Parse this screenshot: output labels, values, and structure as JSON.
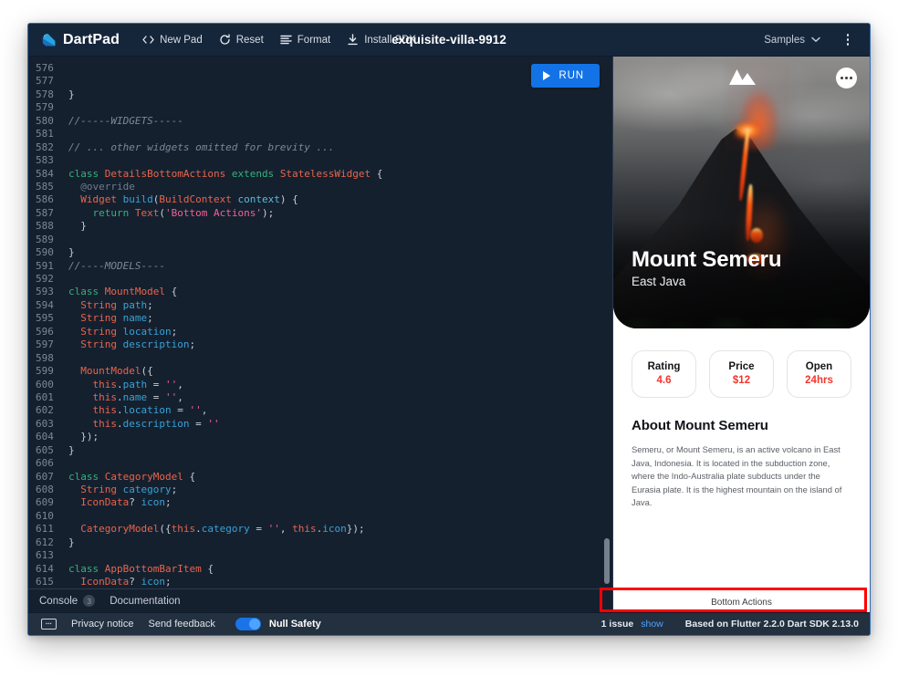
{
  "toolbar": {
    "brand": "DartPad",
    "items": [
      {
        "icon": "code-brackets-icon",
        "label": "New Pad"
      },
      {
        "icon": "refresh-icon",
        "label": "Reset"
      },
      {
        "icon": "format-lines-icon",
        "label": "Format"
      },
      {
        "icon": "download-icon",
        "label": "Install SDK"
      }
    ],
    "doc_title": "exquisite-villa-9912",
    "samples_label": "Samples",
    "overflow_icon": "kebab-menu-icon"
  },
  "editor": {
    "run_label": "RUN",
    "first_line": 576,
    "lines": [
      [
        [
          "pl",
          ""
        ]
      ],
      [
        [
          "pl",
          ""
        ]
      ],
      [
        [
          "pl",
          "}"
        ]
      ],
      [
        [
          "pl",
          ""
        ]
      ],
      [
        [
          "cm",
          "//-----WIDGETS-----"
        ]
      ],
      [
        [
          "pl",
          ""
        ]
      ],
      [
        [
          "cm",
          "// ... other widgets omitted for brevity ..."
        ]
      ],
      [
        [
          "pl",
          ""
        ]
      ],
      [
        [
          "k",
          "class "
        ],
        [
          "ty",
          "DetailsBottomActions"
        ],
        [
          "k",
          " extends "
        ],
        [
          "ty",
          "StatelessWidget"
        ],
        [
          "pl",
          " {"
        ]
      ],
      [
        [
          "an",
          "  @override"
        ]
      ],
      [
        [
          "pl",
          "  "
        ],
        [
          "ty",
          "Widget"
        ],
        [
          "pl",
          " "
        ],
        [
          "fn",
          "build"
        ],
        [
          "pl",
          "("
        ],
        [
          "ty",
          "BuildContext"
        ],
        [
          "pl",
          " "
        ],
        [
          "va",
          "context"
        ],
        [
          "pl",
          ") {"
        ]
      ],
      [
        [
          "pl",
          "    "
        ],
        [
          "k",
          "return "
        ],
        [
          "ty",
          "Text"
        ],
        [
          "pl",
          "("
        ],
        [
          "st",
          "'Bottom Actions'"
        ],
        [
          "pl",
          ");"
        ]
      ],
      [
        [
          "pl",
          "  }"
        ]
      ],
      [
        [
          "pl",
          ""
        ]
      ],
      [
        [
          "pl",
          "}"
        ]
      ],
      [
        [
          "cm",
          "//----MODELS----"
        ]
      ],
      [
        [
          "pl",
          ""
        ]
      ],
      [
        [
          "k",
          "class "
        ],
        [
          "ty",
          "MountModel"
        ],
        [
          "pl",
          " {"
        ]
      ],
      [
        [
          "pl",
          "  "
        ],
        [
          "ty",
          "String"
        ],
        [
          "pl",
          " "
        ],
        [
          "fn",
          "path"
        ],
        [
          "pl",
          ";"
        ]
      ],
      [
        [
          "pl",
          "  "
        ],
        [
          "ty",
          "String"
        ],
        [
          "pl",
          " "
        ],
        [
          "fn",
          "name"
        ],
        [
          "pl",
          ";"
        ]
      ],
      [
        [
          "pl",
          "  "
        ],
        [
          "ty",
          "String"
        ],
        [
          "pl",
          " "
        ],
        [
          "fn",
          "location"
        ],
        [
          "pl",
          ";"
        ]
      ],
      [
        [
          "pl",
          "  "
        ],
        [
          "ty",
          "String"
        ],
        [
          "pl",
          " "
        ],
        [
          "fn",
          "description"
        ],
        [
          "pl",
          ";"
        ]
      ],
      [
        [
          "pl",
          ""
        ]
      ],
      [
        [
          "pl",
          "  "
        ],
        [
          "ty",
          "MountModel"
        ],
        [
          "pl",
          "({"
        ]
      ],
      [
        [
          "pl",
          "    "
        ],
        [
          "tk",
          "this"
        ],
        [
          "pl",
          "."
        ],
        [
          "fn",
          "path"
        ],
        [
          "pl",
          " = "
        ],
        [
          "st",
          "''"
        ],
        [
          "pl",
          ","
        ]
      ],
      [
        [
          "pl",
          "    "
        ],
        [
          "tk",
          "this"
        ],
        [
          "pl",
          "."
        ],
        [
          "fn",
          "name"
        ],
        [
          "pl",
          " = "
        ],
        [
          "st",
          "''"
        ],
        [
          "pl",
          ","
        ]
      ],
      [
        [
          "pl",
          "    "
        ],
        [
          "tk",
          "this"
        ],
        [
          "pl",
          "."
        ],
        [
          "fn",
          "location"
        ],
        [
          "pl",
          " = "
        ],
        [
          "st",
          "''"
        ],
        [
          "pl",
          ","
        ]
      ],
      [
        [
          "pl",
          "    "
        ],
        [
          "tk",
          "this"
        ],
        [
          "pl",
          "."
        ],
        [
          "fn",
          "description"
        ],
        [
          "pl",
          " = "
        ],
        [
          "st",
          "''"
        ]
      ],
      [
        [
          "pl",
          "  });"
        ]
      ],
      [
        [
          "pl",
          "}"
        ]
      ],
      [
        [
          "pl",
          ""
        ]
      ],
      [
        [
          "k",
          "class "
        ],
        [
          "ty",
          "CategoryModel"
        ],
        [
          "pl",
          " {"
        ]
      ],
      [
        [
          "pl",
          "  "
        ],
        [
          "ty",
          "String"
        ],
        [
          "pl",
          " "
        ],
        [
          "fn",
          "category"
        ],
        [
          "pl",
          ";"
        ]
      ],
      [
        [
          "pl",
          "  "
        ],
        [
          "ty",
          "IconData"
        ],
        [
          "pl",
          "? "
        ],
        [
          "fn",
          "icon"
        ],
        [
          "pl",
          ";"
        ]
      ],
      [
        [
          "pl",
          ""
        ]
      ],
      [
        [
          "pl",
          "  "
        ],
        [
          "ty",
          "CategoryModel"
        ],
        [
          "pl",
          "({"
        ],
        [
          "tk",
          "this"
        ],
        [
          "pl",
          "."
        ],
        [
          "fn",
          "category"
        ],
        [
          "pl",
          " = "
        ],
        [
          "st",
          "''"
        ],
        [
          "pl",
          ", "
        ],
        [
          "tk",
          "this"
        ],
        [
          "pl",
          "."
        ],
        [
          "fn",
          "icon"
        ],
        [
          "pl",
          "});"
        ]
      ],
      [
        [
          "pl",
          "}"
        ]
      ],
      [
        [
          "pl",
          ""
        ]
      ],
      [
        [
          "k",
          "class "
        ],
        [
          "ty",
          "AppBottomBarItem"
        ],
        [
          "pl",
          " {"
        ]
      ],
      [
        [
          "pl",
          "  "
        ],
        [
          "ty",
          "IconData"
        ],
        [
          "pl",
          "? "
        ],
        [
          "fn",
          "icon"
        ],
        [
          "pl",
          ";"
        ]
      ]
    ]
  },
  "console": {
    "tab_console": "Console",
    "badge": "3",
    "tab_documentation": "Documentation"
  },
  "preview": {
    "mountain_icon": "mountain-icon",
    "more_icon": "more-horizontal-icon",
    "hero_title": "Mount Semeru",
    "hero_subtitle": "East Java",
    "stats": [
      {
        "label": "Rating",
        "value": "4.6"
      },
      {
        "label": "Price",
        "value": "$12"
      },
      {
        "label": "Open",
        "value": "24hrs"
      }
    ],
    "about_title": "About Mount Semeru",
    "about_body": "Semeru, or Mount Semeru, is an active volcano in East Java, Indonesia. It is located in the subduction zone, where the Indo-Australia plate subducts under the Eurasia plate. It is the highest mountain on the island of Java.",
    "bottom_actions": "Bottom Actions"
  },
  "statusbar": {
    "keyboard_icon": "keyboard-icon",
    "privacy": "Privacy notice",
    "feedback": "Send feedback",
    "null_safety": "Null Safety",
    "issue_text": "1 issue",
    "show_link": "show",
    "sdk_text": "Based on Flutter 2.2.0 Dart SDK 2.13.0"
  },
  "colors": {
    "accent_blue": "#1373e6",
    "link_blue": "#4da3ff",
    "stat_red": "#f0372e",
    "highlight_red": "#ff0000",
    "toolbar_bg": "#15263b",
    "editor_bg": "#15202f",
    "statusbar_bg": "#22303f"
  }
}
